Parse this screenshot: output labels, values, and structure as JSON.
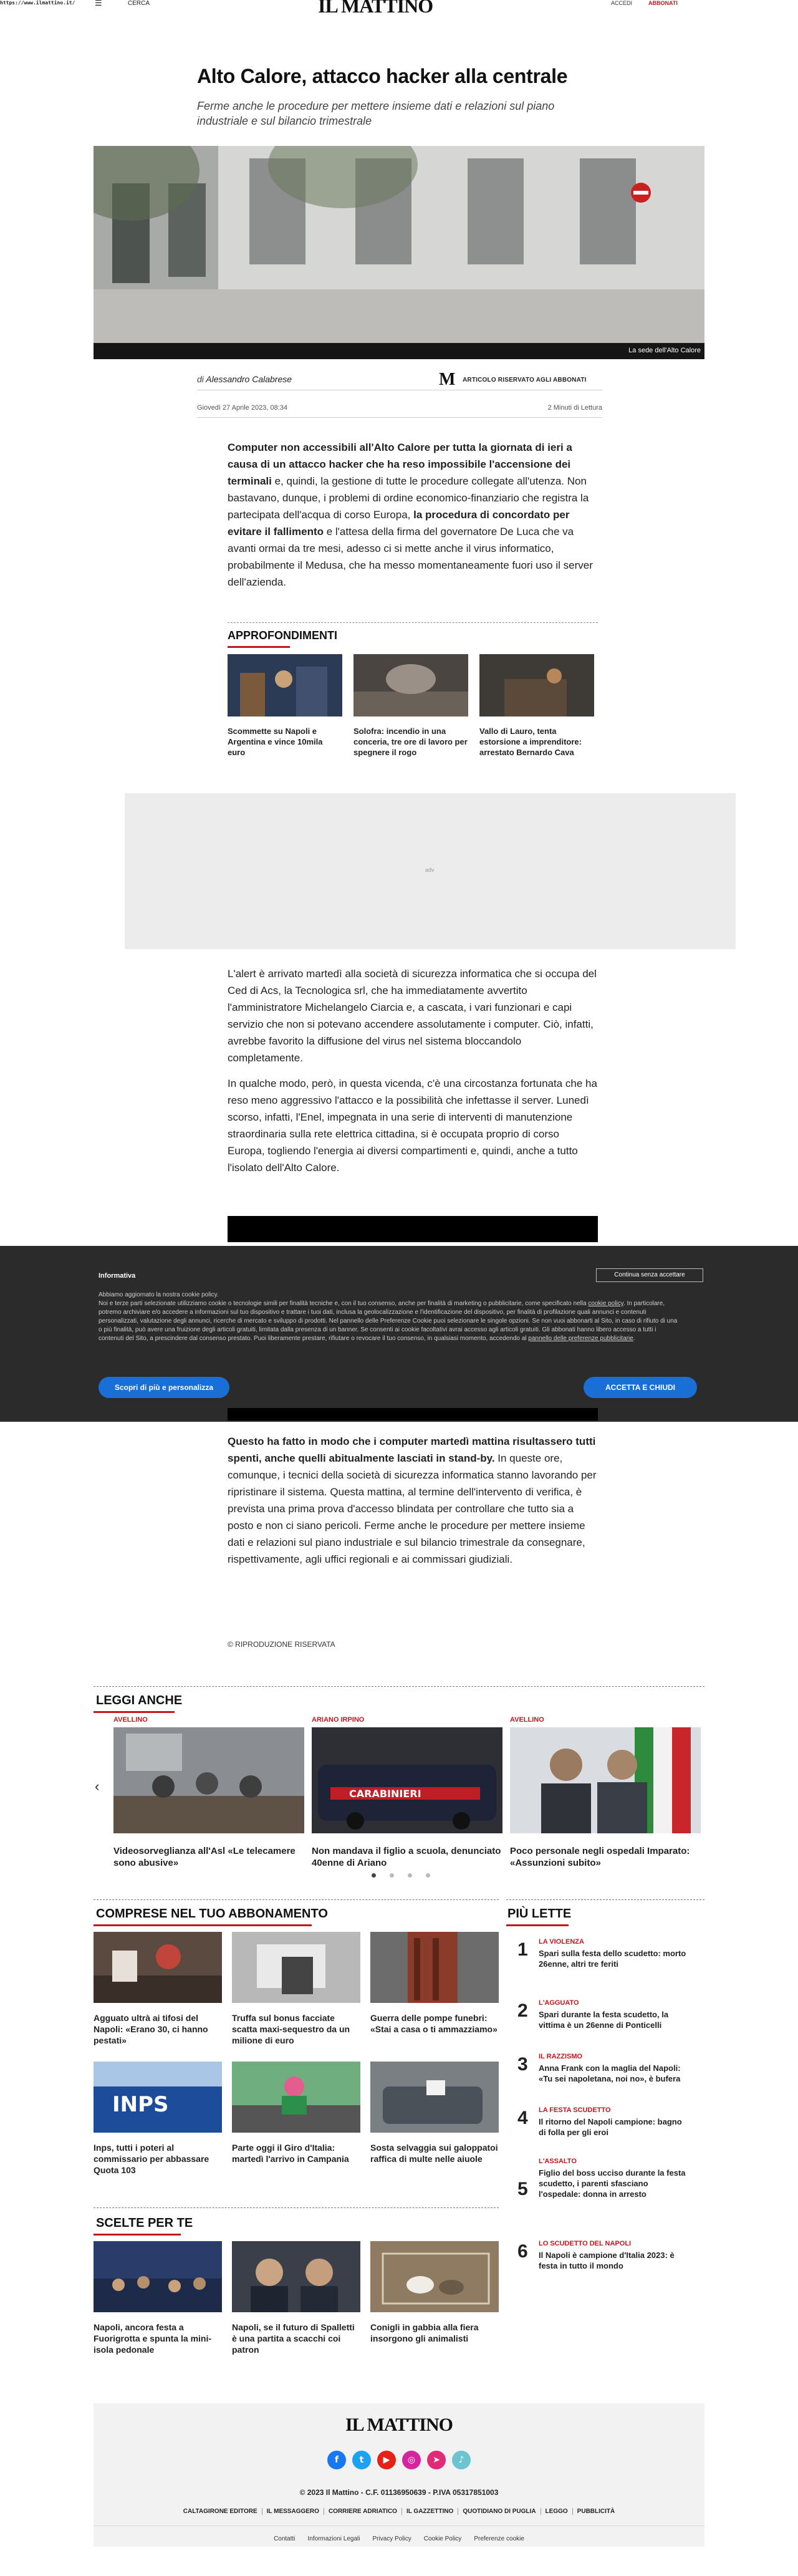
{
  "header": {
    "url": "https://www.ilmattino.it/",
    "menu_icon": "☰",
    "search_label": "CERCA",
    "logo": "IL MATTINO",
    "login": "ACCEDI",
    "subscribe": "ABBONATI"
  },
  "article": {
    "title": "Alto Calore, attacco hacker alla centrale",
    "summary": "Ferme anche le procedure per mettere insieme dati e relazioni sul piano industriale e sul bilancio trimestrale",
    "image_caption": "La sede dell'Alto Calore",
    "author_prefix": "di ",
    "author": "Alessandro Calabrese",
    "reserved_logo": "M",
    "reserved_label": "ARTICOLO RISERVATO AGLI ABBONATI",
    "date": "Giovedì 27 Aprile 2023, 08:34",
    "read_time": "2 Minuti di Lettura",
    "p1_bold": "Computer non accessibili all'Alto Calore per tutta la giornata di ieri a causa di un attacco hacker che ha reso impossibile l'accensione dei terminali",
    "p1_rest1": " e, quindi, la gestione di tutte le procedure collegate all'utenza. Non bastavano, dunque, i problemi di ordine economico-finanziario che registra la partecipata dell'acqua di corso Europa, ",
    "p1_bold2": "la procedura di concordato per evitare il fallimento",
    "p1_rest2": " e l'attesa della firma del governatore De Luca che va avanti ormai da tre mesi, adesso ci si mette anche il virus informatico, probabilmente il Medusa, che ha messo momentaneamente fuori uso il server dell'azienda.",
    "p2": "L'alert è arrivato martedì alla società di sicurezza informatica che si occupa del Ced di Acs, la Tecnologica srl, che ha immediatamente avvertito l'amministratore Michelangelo Ciarcia e, a cascata, i vari funzionari e capi servizio che non si potevano accendere assolutamente i computer. Ciò, infatti, avrebbe favorito la diffusione del virus nel sistema bloccandolo completamente.",
    "p3": "In qualche modo, però, in questa vicenda, c'è una circostanza fortunata che ha reso meno aggressivo l'attacco e la possibilità che infettasse il server. Lunedì scorso, infatti, l'Enel, impegnata in una serie di interventi di manutenzione straordinaria sulla rete elettrica cittadina, si è occupata proprio di corso Europa, togliendo l'energia ai diversi compartimenti e, quindi, anche a tutto l'isolato dell'Alto Calore.",
    "p4_bold": "Questo ha fatto in modo che i computer martedì mattina risultassero tutti spenti, anche quelli abitualmente lasciati in stand-by.",
    "p4_rest": " In queste ore, comunque, i tecnici della società di sicurezza informatica stanno lavorando per ripristinare il sistema. Questa mattina, al termine dell'intervento di verifica, è prevista una prima prova d'accesso blindata per controllare che tutto sia a posto e non ci siano pericoli. Ferme anche le procedure per mettere insieme dati e relazioni sul piano industriale e sul bilancio trimestrale da consegnare, rispettivamente, agli uffici regionali e ai commissari giudiziali.",
    "copyright": "© RIPRODUZIONE RISERVATA"
  },
  "approfondimenti": {
    "title": "APPROFONDIMENTI",
    "items": [
      {
        "text": "Scommette su Napoli e Argentina e vince 10mila euro"
      },
      {
        "text": "Solofra: incendio in una conceria, tre ore di lavoro per spegnere il rogo"
      },
      {
        "text": "Vallo di Lauro, tenta estorsione a imprenditore: arrestato Bernardo Cava"
      }
    ]
  },
  "ad": {
    "label": "adv"
  },
  "cookie": {
    "title": "Informativa",
    "text_1": "Abbiamo aggiornato la nostra cookie policy.",
    "text_2a": "Noi e terze parti selezionate utilizziamo cookie o tecnologie simili per finalità tecniche e, con il tuo consenso, anche per finalità di marketing o pubblicitarie, come specificato nella ",
    "text_2_link": "cookie policy",
    "text_2b": ". In particolare, potremo archiviare e/o accedere a informazioni sul tuo dispositivo e trattare i tuoi dati, inclusa la geolocalizzazione e l'identificazione del dispositivo, per finalità di profilazione quali annunci e contenuti personalizzati, valutazione degli annunci, ricerche di mercato e sviluppo di prodotti. Nel pannello delle Preferenze Cookie puoi selezionare le singole opzioni. Se non vuoi abbonarti al Sito, in caso di rifiuto di una o più finalità, può avere una fruizione degli articoli gratuiti, limitata dalla presenza di un banner. Se consenti ai cookie facoltativi avrai accesso agli articoli gratuiti. Gli abbonati hanno libero accesso a tutti i contenuti del Sito, a prescindere dal consenso prestato. Puoi liberamente prestare, rifiutare o revocare il tuo consenso, in qualsiasi momento, accedendo al ",
    "text_2_link2": "pannello delle preferenze pubblicitarie",
    "text_2c": ".",
    "continue": "Continua senza accettare",
    "more": "Scopri di più e personalizza",
    "accept": "ACCETTA E CHIUDI"
  },
  "leggi_anche": {
    "title": "LEGGI ANCHE",
    "items": [
      {
        "tag": "AVELLINO",
        "text": "Videosorveglianza all'Asl «Le telecamere sono abusive»"
      },
      {
        "tag": "ARIANO IRPINO",
        "text": "Non mandava il figlio a scuola, denunciato 40enne di Ariano"
      },
      {
        "tag": "AVELLINO",
        "text": "Poco personale negli ospedali Imparato: «Assunzioni subito»"
      }
    ],
    "prev": "‹",
    "next": "›"
  },
  "comprese": {
    "title": "COMPRESE NEL TUO ABBONAMENTO",
    "items": [
      {
        "text": "Agguato ultrà ai tifosi del Napoli: «Erano 30, ci hanno pestati»"
      },
      {
        "text": "Truffa sul bonus facciate scatta maxi-sequestro da un milione di euro"
      },
      {
        "text": "Guerra delle pompe funebri: «Stai a casa o ti ammazziamo»"
      },
      {
        "text": "Inps, tutti i poteri al commissario per abbassare Quota 103"
      },
      {
        "text": "Parte oggi il Giro d'Italia: martedì l'arrivo in Campania"
      },
      {
        "text": "Sosta selvaggia sui galoppatoi raffica di multe nelle aiuole"
      }
    ]
  },
  "piu_lette": {
    "title": "PIÙ LETTE",
    "items": [
      {
        "num": "1",
        "tag": "LA VIOLENZA",
        "text": "Spari sulla festa dello scudetto: morto 26enne, altri tre feriti"
      },
      {
        "num": "2",
        "tag": "L'AGGUATO",
        "text": "Spari durante la festa scudetto, la vittima è un 26enne di Ponticelli"
      },
      {
        "num": "3",
        "tag": "IL RAZZISMO",
        "text": "Anna Frank con la maglia del Napoli: «Tu sei napoletana, noi no», è bufera"
      },
      {
        "num": "4",
        "tag": "LA FESTA SCUDETTO",
        "text": "Il ritorno del Napoli campione: bagno di folla per gli eroi"
      },
      {
        "num": "5",
        "tag": "L'ASSALTO",
        "text": "Figlio del boss ucciso durante la festa scudetto, i parenti sfasciano l'ospedale: donna in arresto"
      },
      {
        "num": "6",
        "tag": "LO SCUDETTO DEL NAPOLI",
        "text": "Il Napoli è campione d'Italia 2023: è festa in tutto il mondo"
      }
    ]
  },
  "scelte": {
    "title": "SCELTE PER TE",
    "items": [
      {
        "text": "Napoli, ancora festa a Fuorigrotta e spunta la mini-isola pedonale"
      },
      {
        "text": "Napoli, se il futuro di Spalletti è una partita a scacchi coi patron"
      },
      {
        "text": "Conigli in gabbia alla fiera insorgono gli animalisti"
      }
    ]
  },
  "footer": {
    "logo": "IL MATTINO",
    "copyright": "© 2023 Il Mattino - C.F. 01136950639 - P.IVA 05317851003",
    "links": [
      "CALTAGIRONE EDITORE",
      "IL MESSAGGERO",
      "CORRIERE ADRIATICO",
      "IL GAZZETTINO",
      "QUOTIDIANO DI PUGLIA",
      "LEGGO",
      "PUBBLICITÀ"
    ],
    "bottom": [
      "Contatti",
      "Informazioni Legali",
      "Privacy Policy",
      "Cookie Policy",
      "Preferenze cookie"
    ],
    "social_icons": [
      "facebook-icon",
      "twitter-icon",
      "youtube-icon",
      "instagram-icon",
      "telegram-icon",
      "tiktok-icon"
    ]
  }
}
